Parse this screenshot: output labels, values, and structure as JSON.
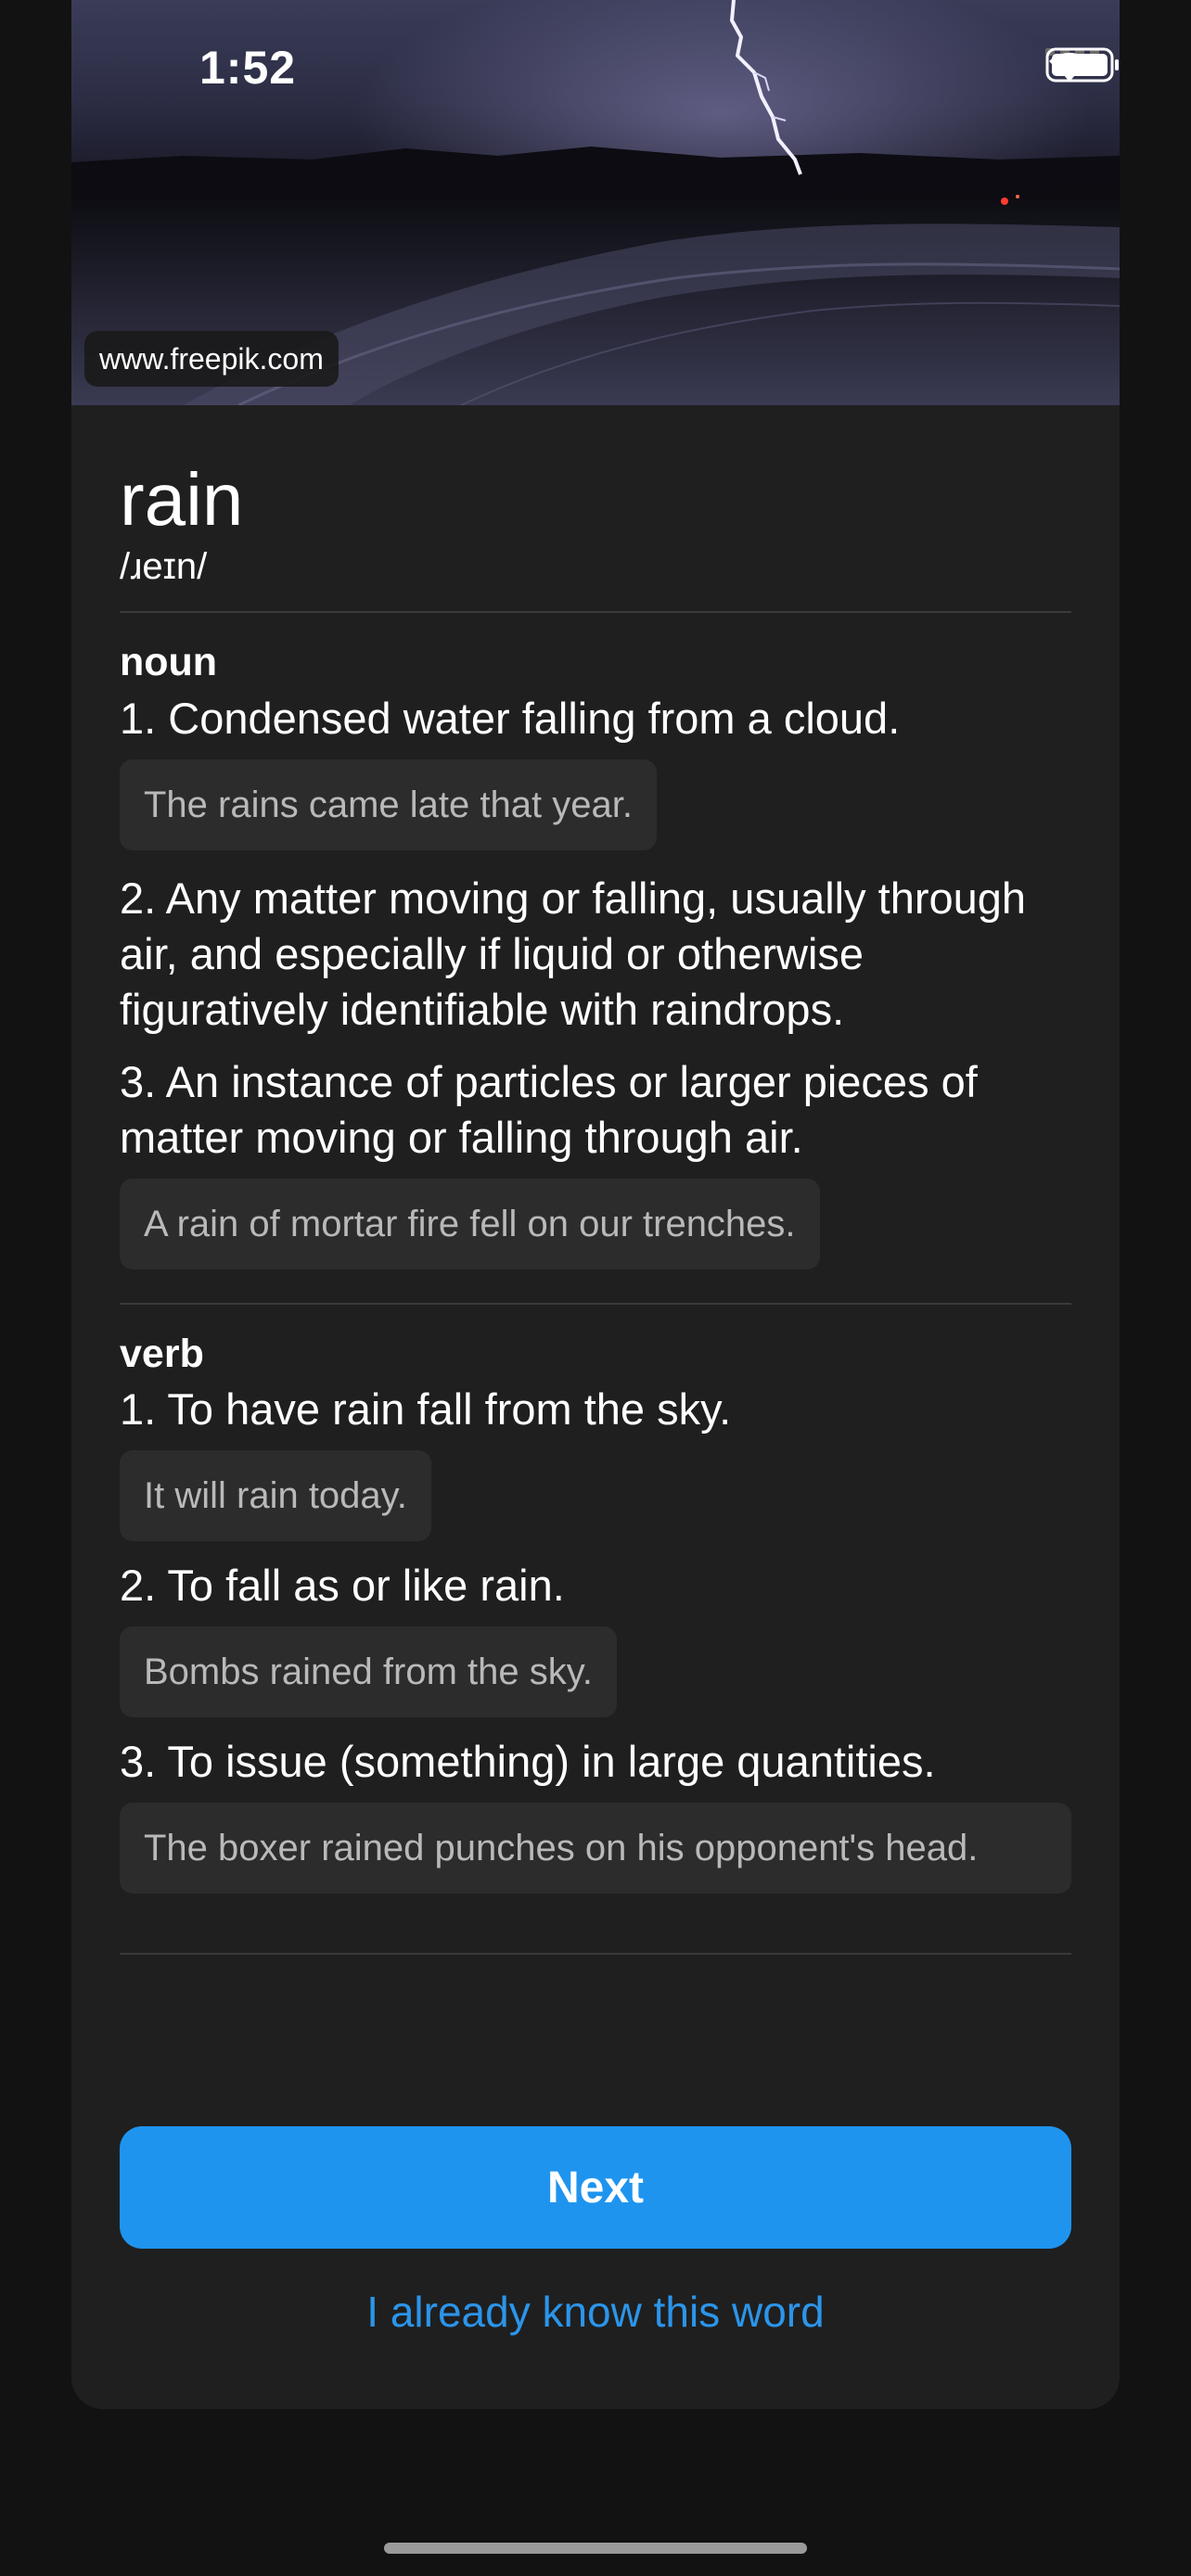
{
  "status_bar": {
    "time": "1:52",
    "icons": [
      "signal-icon",
      "wifi-icon",
      "battery-icon"
    ]
  },
  "hero": {
    "credit": "www.freepik.com"
  },
  "word": {
    "title": "rain",
    "phonetic": "/ɹeɪn/"
  },
  "sections": [
    {
      "pos": "noun",
      "definitions": [
        {
          "text": "1. Condensed water falling from a cloud.",
          "example": "The rains came late that year."
        },
        {
          "text": "2. Any matter moving or falling, usually through air, and especially if liquid or otherwise figuratively identifiable with raindrops.",
          "example": null
        },
        {
          "text": "3. An instance of particles or larger pieces of matter moving or falling through air.",
          "example": "A rain of mortar fire fell on our trenches."
        }
      ]
    },
    {
      "pos": "verb",
      "definitions": [
        {
          "text": "1. To have rain fall from the sky.",
          "example": "It will rain today."
        },
        {
          "text": "2. To fall as or like rain.",
          "example": "Bombs rained from the sky."
        },
        {
          "text": "3. To issue (something) in large quantities.",
          "example": "The boxer rained punches on his opponent's head."
        }
      ]
    }
  ],
  "actions": {
    "next_label": "Next",
    "know_label": "I already know this word"
  },
  "colors": {
    "background": "#121212",
    "card": "#1f1f1f",
    "example_bg": "#2c2c2c",
    "accent": "#1f94ef"
  }
}
